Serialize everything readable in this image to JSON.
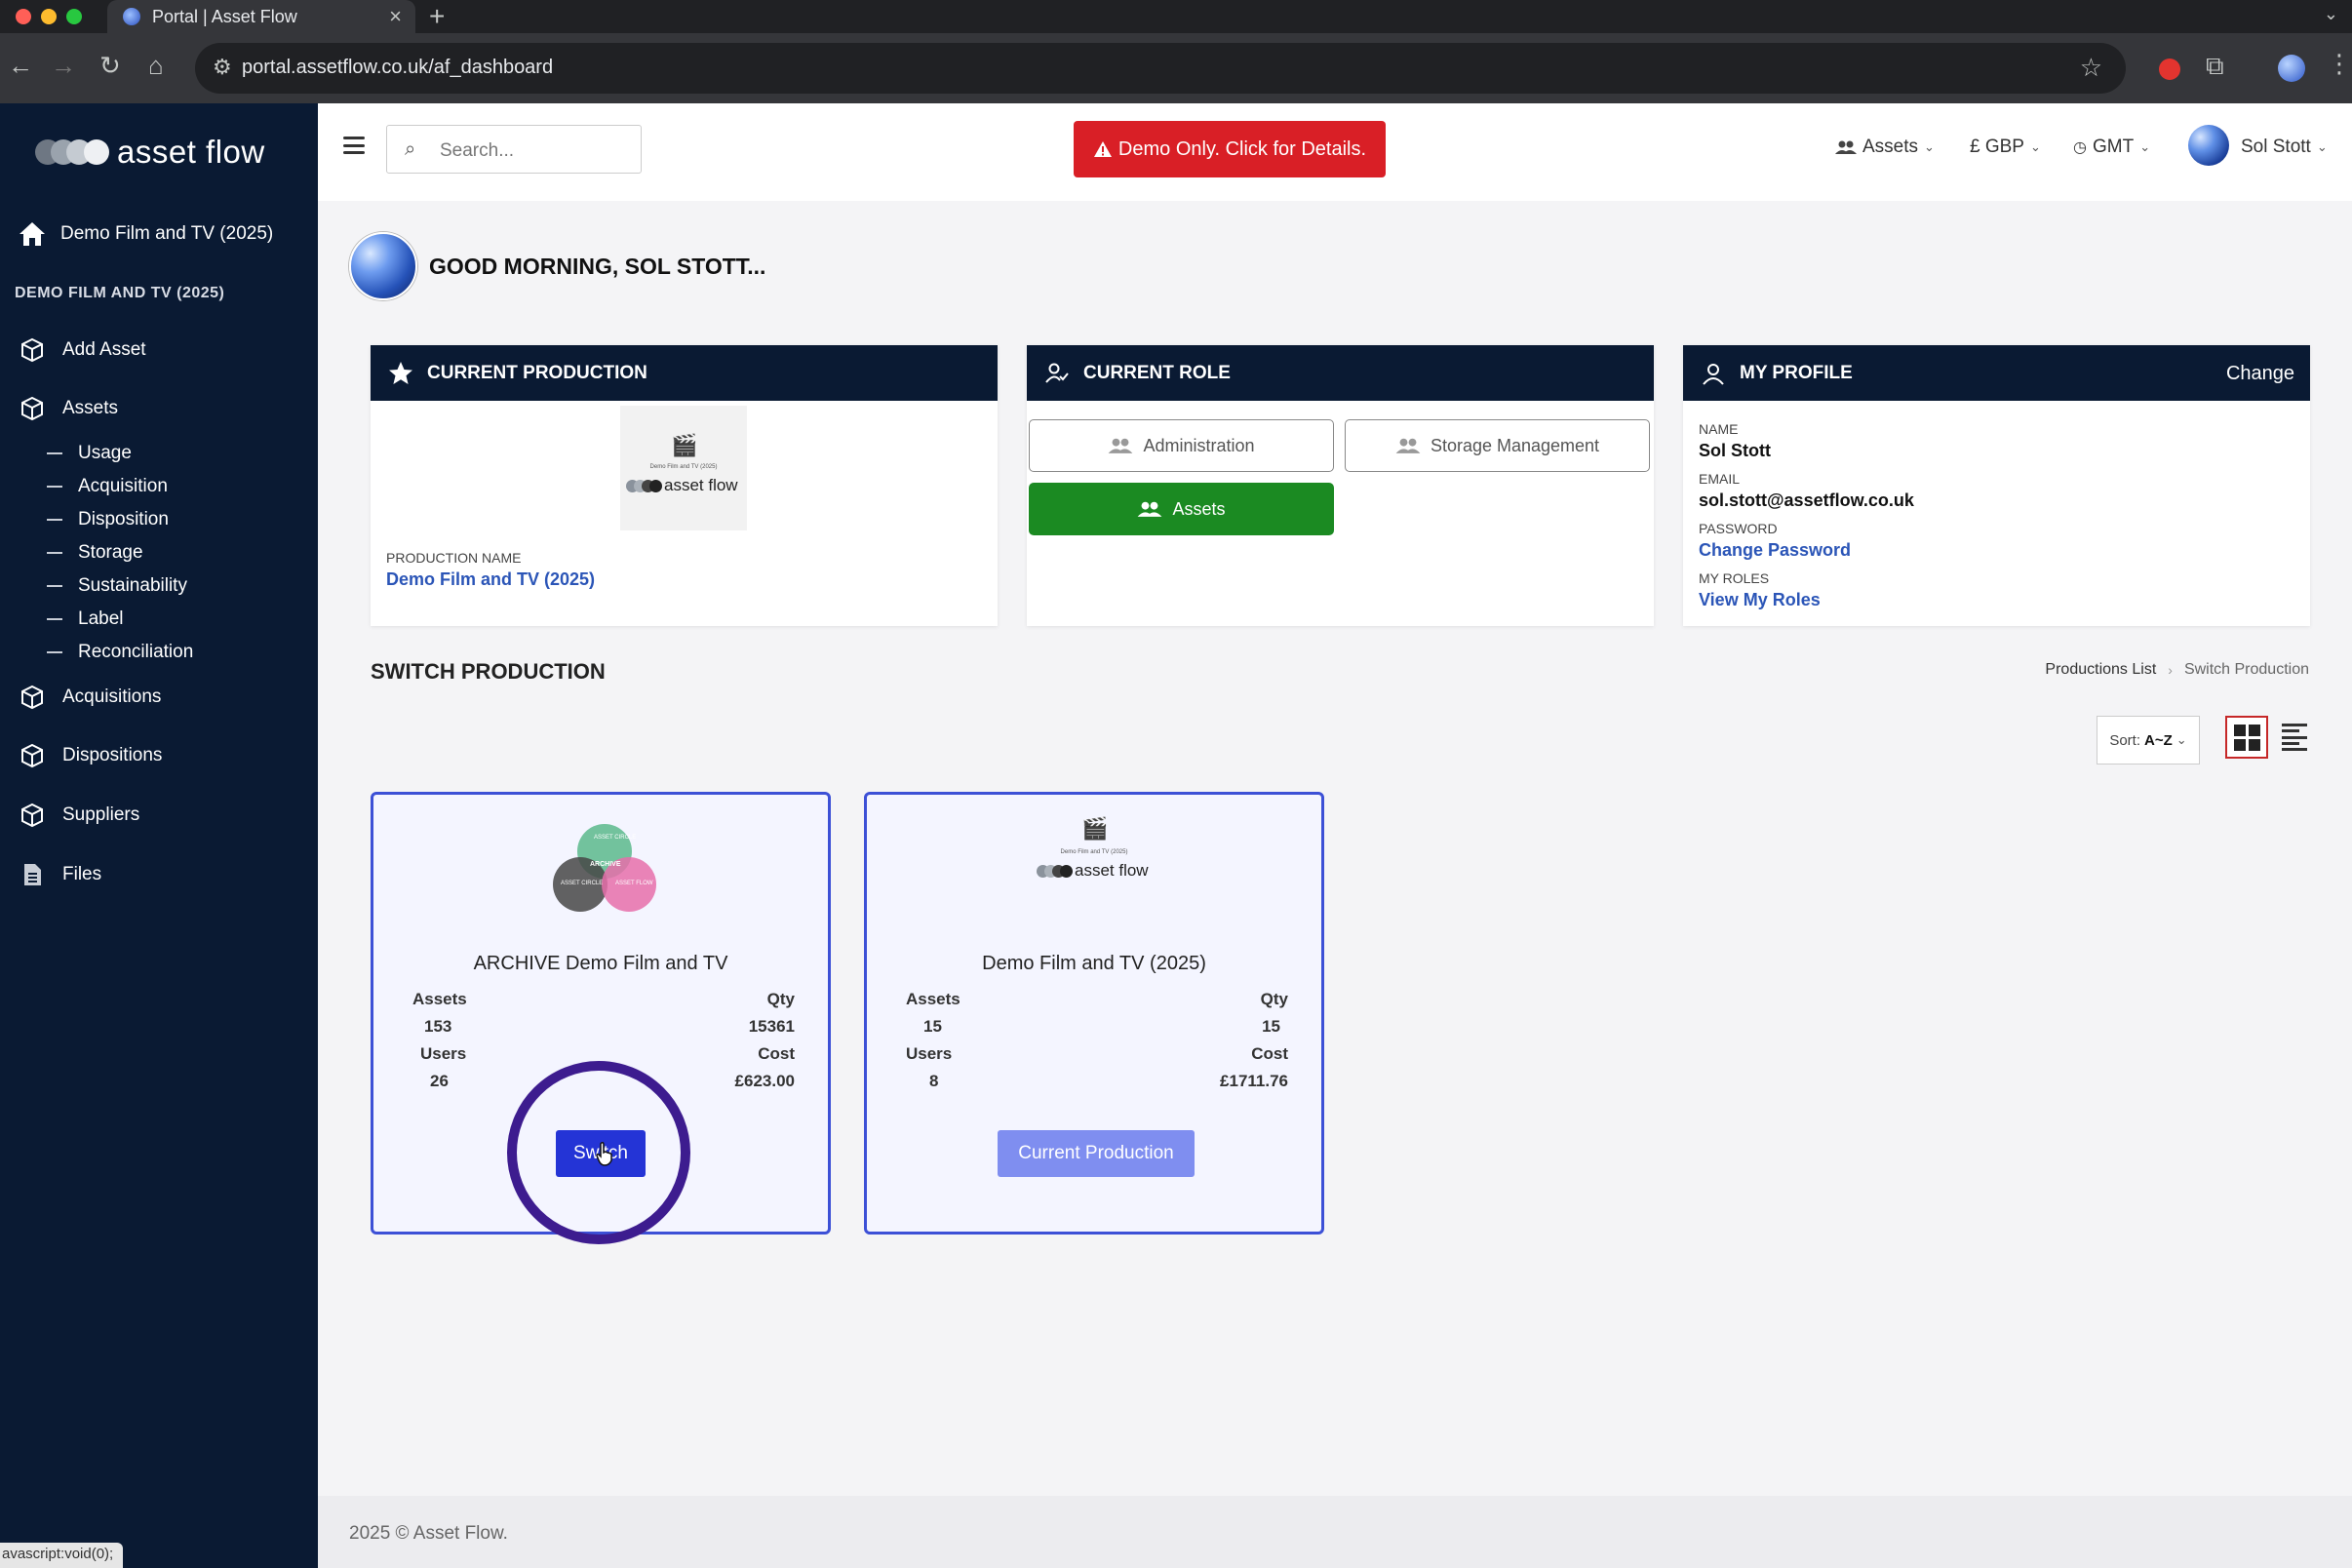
{
  "browser": {
    "tab_title": "Portal | Asset Flow",
    "tab_close": "×",
    "new_tab": "+",
    "url": "portal.assetflow.co.uk/af_dashboard",
    "status_url": "avascript:void(0);"
  },
  "brand": {
    "logo_text": "asset flow",
    "dot_colors": [
      "#9aa3ad",
      "#c5cbd2",
      "#eef0f3"
    ]
  },
  "sidebar": {
    "home_label": "Demo Film and TV (2025)",
    "section_title": "DEMO FILM AND TV (2025)",
    "items": [
      {
        "label": "Add Asset",
        "icon": "cube-icon"
      },
      {
        "label": "Assets",
        "icon": "cube-icon"
      },
      {
        "label": "Acquisitions",
        "icon": "cube-icon"
      },
      {
        "label": "Dispositions",
        "icon": "cube-icon"
      },
      {
        "label": "Suppliers",
        "icon": "cube-icon"
      },
      {
        "label": "Files",
        "icon": "file-icon"
      }
    ],
    "sub_items": [
      "Usage",
      "Acquisition",
      "Disposition",
      "Storage",
      "Sustainability",
      "Label",
      "Reconciliation"
    ]
  },
  "topbar": {
    "search_placeholder": "Search...",
    "demo_label": "Demo Only. Click for Details.",
    "assets_dropdown": "Assets",
    "currency_dropdown": "£ GBP",
    "timezone_dropdown": "GMT",
    "user_name": "Sol Stott",
    "demo_color": "#d91f26"
  },
  "greeting": "GOOD MORNING, SOL STOTT...",
  "current_production": {
    "title": "CURRENT PRODUCTION",
    "field_label": "PRODUCTION NAME",
    "production_name": "Demo Film and TV (2025)",
    "logo_tiny_text": "Demo Film and TV (2025)",
    "logo_text": "asset flow"
  },
  "current_role": {
    "title": "CURRENT ROLE",
    "roles": [
      "Administration",
      "Storage Management",
      "Assets"
    ],
    "active_role": "Assets",
    "active_color": "#1b8a22"
  },
  "my_profile": {
    "title": "MY PROFILE",
    "change_label": "Change",
    "name_label": "NAME",
    "name": "Sol Stott",
    "email_label": "EMAIL",
    "email": "sol.stott@assetflow.co.uk",
    "password_label": "PASSWORD",
    "password_link": "Change Password",
    "roles_label": "MY ROLES",
    "roles_link": "View My Roles"
  },
  "switch_production": {
    "title": "SWITCH PRODUCTION",
    "breadcrumb": [
      "Productions List",
      "Switch Production"
    ],
    "sort_label": "Sort:",
    "sort_value": "A~Z",
    "productions": [
      {
        "name": "ARCHIVE Demo Film and TV",
        "assets_label": "Assets",
        "assets": "153",
        "qty_label": "Qty",
        "qty": "15361",
        "users_label": "Users",
        "users": "26",
        "cost_label": "Cost",
        "cost": "£623.00",
        "action_label": "Switch",
        "venn_labels": [
          "ASSET CIRCLE",
          "ASSET CIRCLE",
          "ASSET FLOW"
        ],
        "venn_center": "ARCHIVE"
      },
      {
        "name": "Demo Film and TV (2025)",
        "assets_label": "Assets",
        "assets": "15",
        "qty_label": "Qty",
        "qty": "15",
        "users_label": "Users",
        "users": "8",
        "cost_label": "Cost",
        "cost": "£1711.76",
        "action_label": "Current Production",
        "logo_tiny_text": "Demo Film and TV (2025)",
        "logo_text": "asset flow"
      }
    ]
  },
  "footer": {
    "text": "2025 © Asset Flow."
  },
  "colors": {
    "sidebar": "#0a1a33",
    "accent_blue": "#2434d6",
    "link": "#2b55b7"
  }
}
